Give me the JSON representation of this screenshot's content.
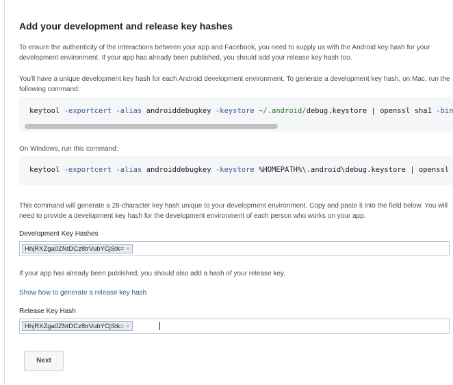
{
  "title": "Add your development and release key hashes",
  "intro": "To ensure the authenticity of the interactions between your app and Facebook, you need to supply us with the Android key hash for your development environment. If your app has already been published, you should add your release key hash too.",
  "mac_instructions": "You'll have a unique development key hash for each Android development environment. To generate a development key hash, on Mac, run the following command:",
  "mac_command": {
    "p1": "keytool ",
    "p2": "-exportcert ",
    "p3": "-alias",
    "p4": " androiddebugkey ",
    "p5": "-keystore",
    "p6": " ",
    "p7": "~/.android/",
    "p8": "debug.keystore | openssl sha1 ",
    "p9": "-binary"
  },
  "windows_instructions": "On Windows, run this command:",
  "windows_command": {
    "p1": "keytool ",
    "p2": "-exportcert ",
    "p3": "-alias",
    "p4": " androiddebugkey ",
    "p5": "-keystore",
    "p6": " %HOMEPATH%\\.android\\debug.keystore | openssl sha"
  },
  "explanation": "This command will generate a 28-character key hash unique to your development environment. Copy and paste it into the field below. You will need to provide a development key hash for the development environment of each person who works on your app.",
  "dev_hashes": {
    "label": "Development Key Hashes",
    "token": "HhjRXZga0ZNtDCz8trVubYCjStk=",
    "remove": "×"
  },
  "release_note": "If your app has already been published, you should also add a hash of your release key.",
  "release_link": "Show how to generate a release key hash",
  "release_hash": {
    "label": "Release Key Hash",
    "token": "HhjRXZga0ZNtDCz8trVubYCjStk=",
    "remove": "×"
  },
  "next_label": "Next"
}
